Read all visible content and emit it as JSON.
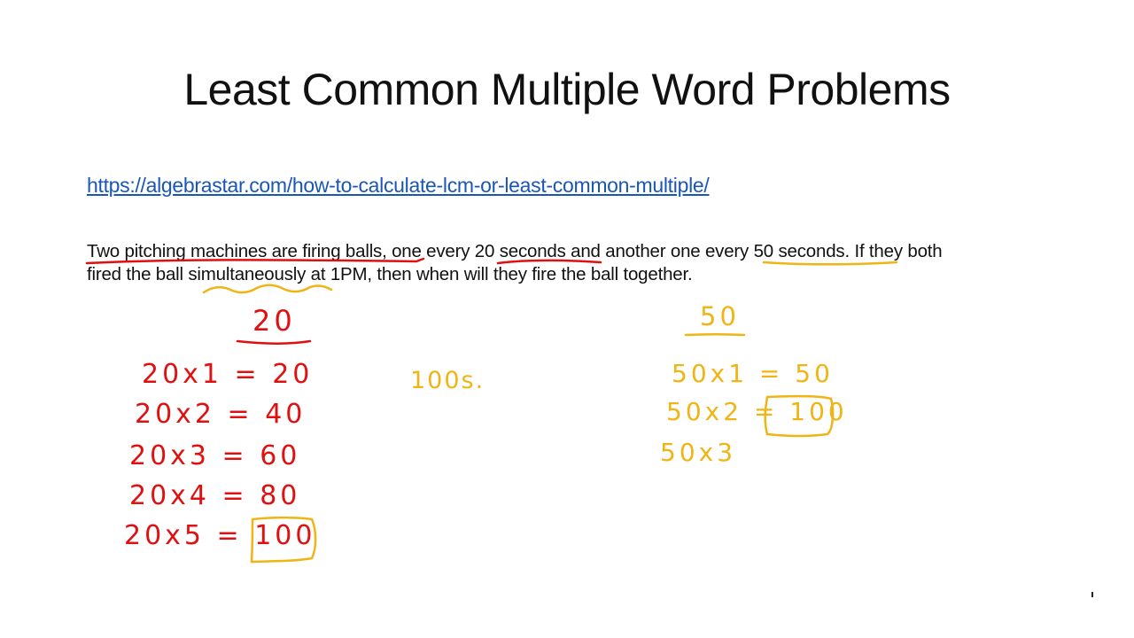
{
  "slide": {
    "title": "Least Common Multiple Word Problems",
    "link": "https://algebrastar.com/how-to-calculate-lcm-or-least-common-multiple/",
    "problem_line1": "Two pitching machines are firing balls, one every 20 seconds and another one every 50 seconds. If they both",
    "problem_line2": "fired the ball simultaneously at 1PM, then when will they fire the ball together."
  },
  "annotations": {
    "colors": {
      "red": "#e01010",
      "yellow": "#f0b414"
    },
    "left_column": {
      "header": "20",
      "rows": [
        "20x1 = 20",
        "20x2 = 40",
        "20x3 = 60",
        "20x4 = 80",
        "20x5 = 100"
      ],
      "boxed_answer": "100"
    },
    "middle_note": "100s.",
    "right_column": {
      "header": "50",
      "rows": [
        "50x1 = 50",
        "50x2 = 100",
        "50x3"
      ],
      "boxed_answer": "100"
    }
  }
}
